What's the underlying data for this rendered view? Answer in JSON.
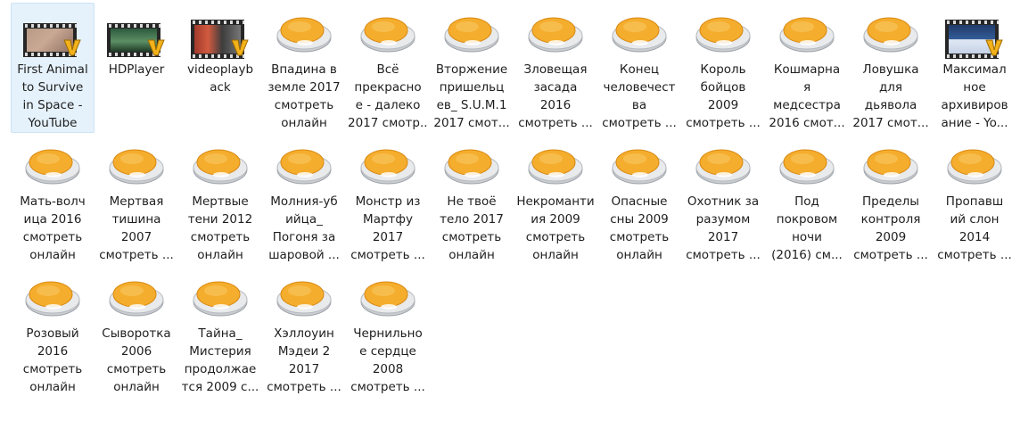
{
  "window": {
    "view": "large-icons"
  },
  "colors": {
    "selection_bg": "#e5f1fb",
    "selection_border": "#cce4f7",
    "disc_fill": "#f5ad2d",
    "disc_base": "#cfd3d6"
  },
  "files": [
    {
      "label": "First Animal\nto Survive\nin Space -\nYouTube",
      "icon": "video-thumbnail-icon",
      "selected": true
    },
    {
      "label": "HDPlayer",
      "icon": "video-thumbnail-icon",
      "selected": false
    },
    {
      "label": "videoplayb\nack",
      "icon": "video-thumbnail-icon",
      "selected": false
    },
    {
      "label": "Впадина в\nземле 2017\nсмотреть\nонлайн",
      "icon": "media-file-icon",
      "selected": false
    },
    {
      "label": "Всё\nпрекрасно\ne - далеко\n2017 смотр...",
      "icon": "media-file-icon",
      "selected": false
    },
    {
      "label": "Вторжение\nпришельц\nев_ S.U.M.1\n2017 смот...",
      "icon": "media-file-icon",
      "selected": false
    },
    {
      "label": "Зловещая\nзасада\n2016\nсмотреть ...",
      "icon": "media-file-icon",
      "selected": false
    },
    {
      "label": "Конец\nчеловечест\nва\nсмотреть ...",
      "icon": "media-file-icon",
      "selected": false
    },
    {
      "label": "Король\nбойцов\n2009\nсмотреть ...",
      "icon": "media-file-icon",
      "selected": false
    },
    {
      "label": "Кошмарна\nя\nмедсестра\n2016 смот...",
      "icon": "media-file-icon",
      "selected": false
    },
    {
      "label": "Ловушка\nдля\nдьявола\n2017 смот...",
      "icon": "media-file-icon",
      "selected": false
    },
    {
      "label": "Максимал\nное\nархивиров\nание - Yo...",
      "icon": "video-thumbnail-icon",
      "selected": false
    },
    {
      "label": "Мать-волч\nица 2016\nсмотреть\nонлайн",
      "icon": "media-file-icon",
      "selected": false
    },
    {
      "label": "Мертвая\nтишина\n2007\nсмотреть ...",
      "icon": "media-file-icon",
      "selected": false
    },
    {
      "label": "Мертвые\nтени 2012\nсмотреть\nонлайн",
      "icon": "media-file-icon",
      "selected": false
    },
    {
      "label": "Молния-уб\nийца_\nПогоня за\nшаровой ...",
      "icon": "media-file-icon",
      "selected": false
    },
    {
      "label": "Монстр из\nМартфу\n2017\nсмотреть ...",
      "icon": "media-file-icon",
      "selected": false
    },
    {
      "label": "Не твоё\nтело 2017\nсмотреть\nонлайн",
      "icon": "media-file-icon",
      "selected": false
    },
    {
      "label": "Некроманти\nия 2009\nсмотреть\nонлайн",
      "icon": "media-file-icon",
      "selected": false
    },
    {
      "label": "Опасные\nсны 2009\nсмотреть\nонлайн",
      "icon": "media-file-icon",
      "selected": false
    },
    {
      "label": "Охотник за\nразумом\n2017\nсмотреть ...",
      "icon": "media-file-icon",
      "selected": false
    },
    {
      "label": "Под\nпокровом\nночи\n(2016) см...",
      "icon": "media-file-icon",
      "selected": false
    },
    {
      "label": "Пределы\nконтроля\n2009\nсмотреть ...",
      "icon": "media-file-icon",
      "selected": false
    },
    {
      "label": "Пропавш\nий слон\n2014\nсмотреть ...",
      "icon": "media-file-icon",
      "selected": false
    },
    {
      "label": "Розовый\n2016\nсмотреть\nонлайн",
      "icon": "media-file-icon",
      "selected": false
    },
    {
      "label": "Сыворотка\n2006\nсмотреть\nонлайн",
      "icon": "media-file-icon",
      "selected": false
    },
    {
      "label": "Тайна_\nМистерия\nпродолжае\nтся 2009 с...",
      "icon": "media-file-icon",
      "selected": false
    },
    {
      "label": "Хэллоуин\nМэдеи 2\n2017\nсмотреть ...",
      "icon": "media-file-icon",
      "selected": false
    },
    {
      "label": "Чернильно\nе сердце\n2008\nсмотреть ...",
      "icon": "media-file-icon",
      "selected": false
    }
  ]
}
